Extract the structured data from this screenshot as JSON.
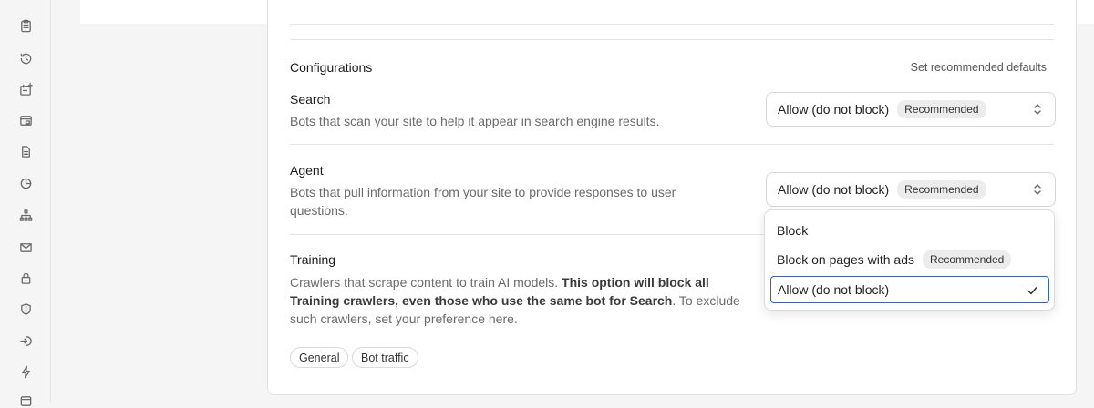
{
  "sidebar": {
    "icons": [
      "clipboard-icon",
      "history-icon",
      "calendar-add-icon",
      "browser-window-icon",
      "document-icon",
      "pie-chart-icon",
      "sitemap-icon",
      "mail-icon",
      "lock-icon",
      "shield-icon",
      "login-icon",
      "lightning-icon",
      "box-icon"
    ]
  },
  "configurations": {
    "title": "Configurations",
    "set_defaults_label": "Set recommended defaults"
  },
  "search": {
    "title": "Search",
    "description": "Bots that scan your site to help it appear in search engine results.",
    "select_value": "Allow (do not block)",
    "badge": "Recommended"
  },
  "agent": {
    "title": "Agent",
    "description_line1": "Bots that pull information from your site to provide responses to user",
    "description_line2": "questions.",
    "select_value": "Allow (do not block)",
    "badge": "Recommended"
  },
  "training": {
    "title": "Training",
    "desc_part1": "Crawlers that scrape content to train AI models. ",
    "desc_bold1": "This option will block all",
    "desc_bold2": "Training crawlers, even those who use the same bot for Search",
    "desc_part2": ". To exclude",
    "desc_line3": "such crawlers, set your preference here.",
    "tags": [
      "General",
      "Bot traffic"
    ]
  },
  "dropdown": {
    "options": [
      {
        "label": "Block",
        "badge": ""
      },
      {
        "label": "Block on pages with ads",
        "badge": "Recommended"
      },
      {
        "label": "Allow (do not block)",
        "badge": "",
        "selected": true
      }
    ]
  },
  "colors": {
    "accent": "#2b63d9",
    "badge_bg": "#ececec"
  }
}
